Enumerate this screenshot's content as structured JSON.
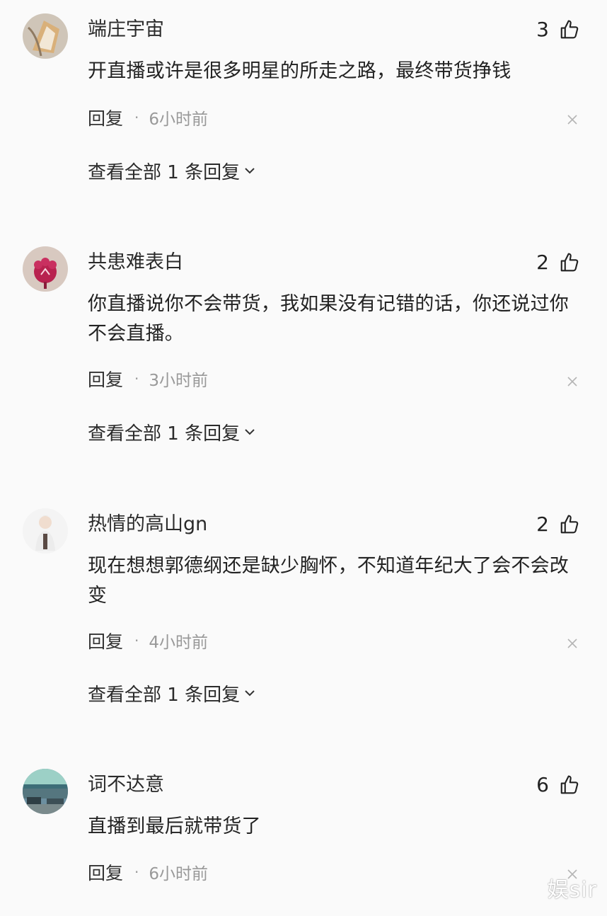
{
  "comments": [
    {
      "username": "端庄宇宙",
      "likes": "3",
      "text": "开直播或许是很多明星的所走之路，最终带货挣钱",
      "reply_label": "回复",
      "separator": "·",
      "time": "6小时前",
      "view_replies": "查看全部 1 条回复"
    },
    {
      "username": "共患难表白",
      "likes": "2",
      "text": "你直播说你不会带货，我如果没有记错的话，你还说过你不会直播。",
      "reply_label": "回复",
      "separator": "·",
      "time": "3小时前",
      "view_replies": "查看全部 1 条回复"
    },
    {
      "username": "热情的高山gn",
      "likes": "2",
      "text": "现在想想郭德纲还是缺少胸怀，不知道年纪大了会不会改变",
      "reply_label": "回复",
      "separator": "·",
      "time": "4小时前",
      "view_replies": "查看全部 1 条回复"
    },
    {
      "username": "词不达意",
      "likes": "6",
      "text": "直播到最后就带货了",
      "reply_label": "回复",
      "separator": "·",
      "time": "6小时前"
    }
  ],
  "icons": {
    "like": "thumbs-up-icon",
    "close": "close-icon",
    "chevron": "chevron-down-icon"
  },
  "watermark": "娱sir",
  "colors": {
    "background": "#fafafa",
    "text": "#222222",
    "muted": "#999999"
  }
}
